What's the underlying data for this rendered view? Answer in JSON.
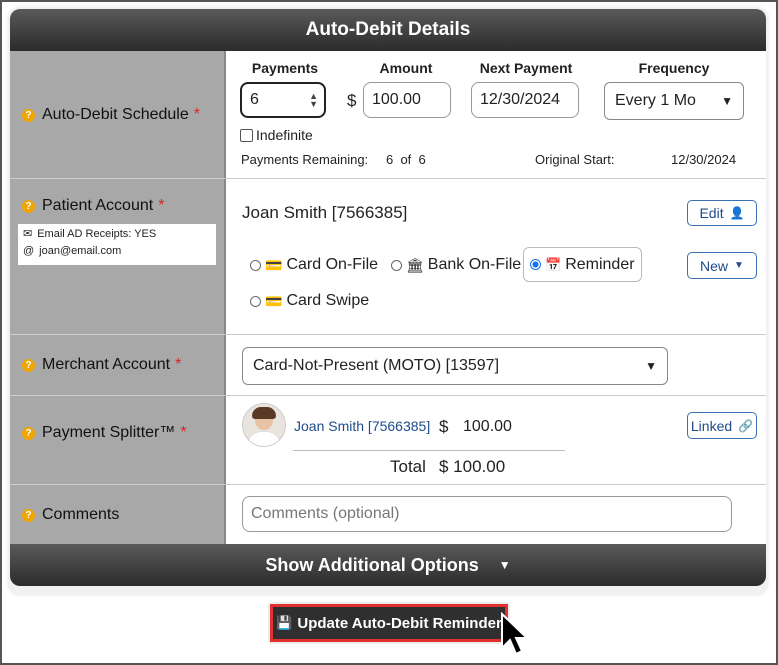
{
  "header": {
    "title": "Auto-Debit Details"
  },
  "schedule": {
    "label": "Auto-Debit Schedule",
    "payments_header": "Payments",
    "amount_header": "Amount",
    "next_payment_header": "Next Payment",
    "frequency_header": "Frequency",
    "payments_value": "6",
    "currency_symbol": "$",
    "amount_value": "100.00",
    "next_payment_value": "12/30/2024",
    "frequency_value": "Every 1 Mo",
    "indefinite_label": "Indefinite",
    "payments_remaining_label": "Payments Remaining:",
    "payments_remaining_value": "6  of  6",
    "original_start_label": "Original Start:",
    "original_start_value": "12/30/2024"
  },
  "patient": {
    "label": "Patient Account",
    "email_receipts": "Email AD Receipts: YES",
    "email": "joan@email.com",
    "name": "Joan Smith [7566385]",
    "edit_label": "Edit",
    "new_label": "New",
    "options": {
      "card_on_file": "Card On-File",
      "bank_on_file": "Bank On-File",
      "reminder": "Reminder",
      "card_swipe": "Card Swipe"
    }
  },
  "merchant": {
    "label": "Merchant Account",
    "value": "Card-Not-Present (MOTO) [13597]"
  },
  "splitter": {
    "label": "Payment Splitter™",
    "name": "Joan Smith [7566385]",
    "currency_symbol": "$",
    "amount": "100.00",
    "total_label": "Total",
    "total_value": "$ 100.00",
    "linked_label": "Linked"
  },
  "comments": {
    "label": "Comments",
    "placeholder": "Comments (optional)"
  },
  "footer": {
    "show_options": "Show Additional Options",
    "update_button": "Update Auto-Debit Reminder"
  },
  "colors": {
    "accent_red": "#e3312f",
    "link_blue": "#1e4b8a",
    "required": "#d22222",
    "help_orange": "#f0a500"
  }
}
